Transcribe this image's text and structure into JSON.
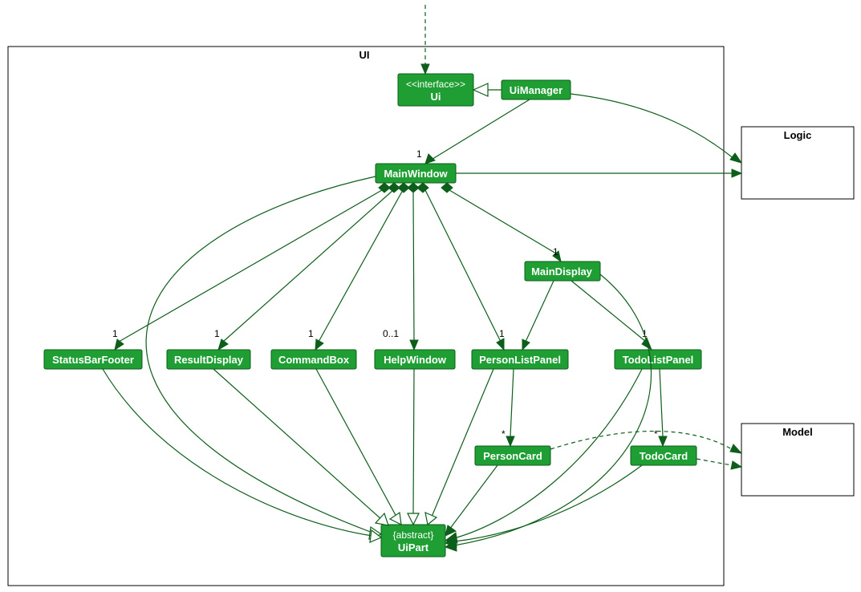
{
  "packages": {
    "ui": "UI",
    "logic": "Logic",
    "model": "Model"
  },
  "nodes": {
    "ui_interface_stereo": "<<interface>>",
    "ui_interface_name": "Ui",
    "uimanager": "UiManager",
    "mainwindow": "MainWindow",
    "maindisplay": "MainDisplay",
    "statusbarfooter": "StatusBarFooter",
    "resultdisplay": "ResultDisplay",
    "commandbox": "CommandBox",
    "helpwindow": "HelpWindow",
    "personlistpanel": "PersonListPanel",
    "todolistpanel": "TodoListPanel",
    "personcard": "PersonCard",
    "todocard": "TodoCard",
    "uipart_stereo": "{abstract}",
    "uipart_name": "UiPart"
  },
  "mult": {
    "one": "1",
    "zero_one": "0..1",
    "star": "*"
  }
}
